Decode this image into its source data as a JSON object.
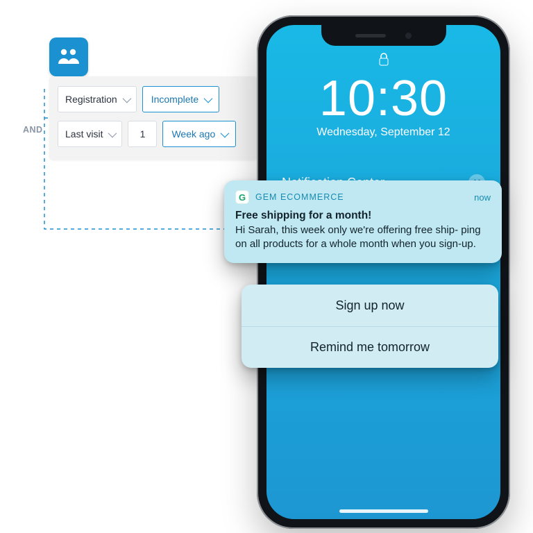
{
  "segment": {
    "operator": "AND",
    "row1": {
      "field": "Registration",
      "value": "Incomplete"
    },
    "row2": {
      "field": "Last visit",
      "count": "1",
      "unit": "Week ago"
    }
  },
  "lockscreen": {
    "time": "10:30",
    "date": "Wednesday, September 12",
    "section": "Notification Center"
  },
  "notification": {
    "app": "GEM ECOMMERCE",
    "when": "now",
    "title": "Free shipping for a month!",
    "body": "Hi Sarah, this week only we're offering free ship-\nping on all products for a whole month when you sign-up."
  },
  "actions": {
    "primary": "Sign up now",
    "secondary": "Remind me tomorrow"
  }
}
